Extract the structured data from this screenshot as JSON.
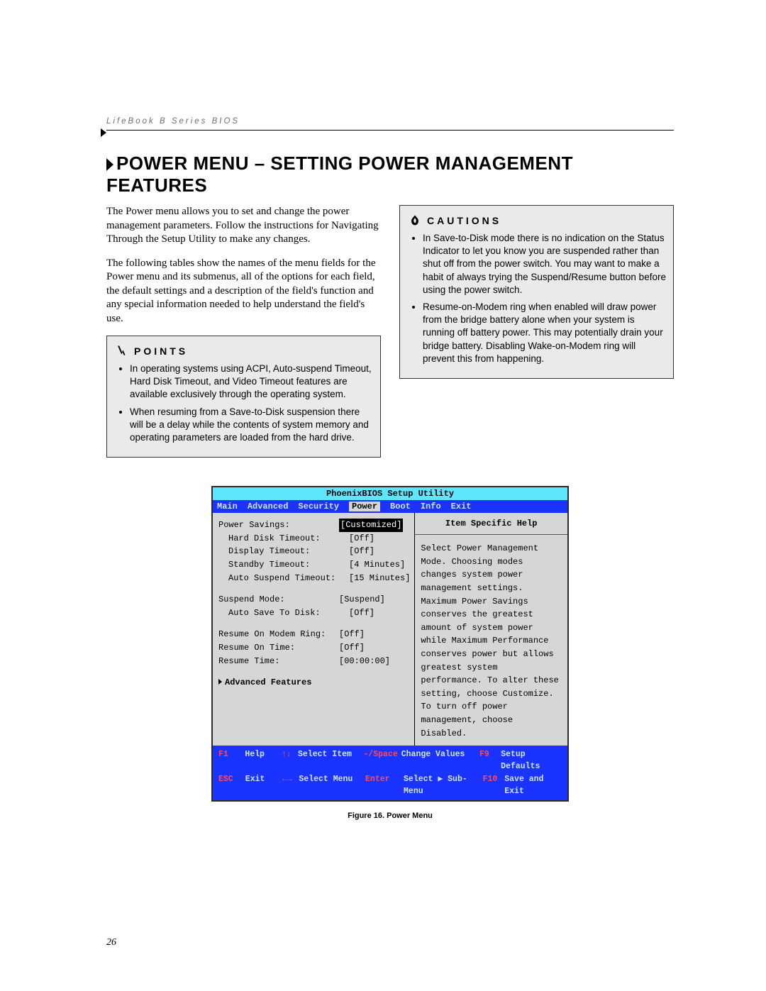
{
  "header": "LifeBook B Series BIOS",
  "title": "POWER MENU – SETTING POWER MANAGEMENT FEATURES",
  "intro": [
    "The Power menu allows you to set and change the power management parameters. Follow the instructions for Navigating Through the Setup Utility to make any changes.",
    "The following tables show the names of the menu fields for the Power menu and its submenus, all of the options for each field, the default settings and a description of the field's function and any special information needed to help understand the field's use."
  ],
  "points": {
    "label": "POINTS",
    "items": [
      "In operating systems using ACPI, Auto-suspend Timeout, Hard Disk Timeout, and Video Timeout features are available exclusively through the operating system.",
      "When resuming from a Save-to-Disk suspension there will be a delay while the contents of system memory and operating parameters are loaded from the hard drive."
    ]
  },
  "cautions": {
    "label": "CAUTIONS",
    "items": [
      "In Save-to-Disk mode there is no indication on the Status Indicator to let you know you are suspended rather than shut off from the power switch. You may want to make a habit of always trying the Suspend/Resume button before using the power switch.",
      "Resume-on-Modem ring when enabled will draw power from the bridge battery alone when your system is running off battery power. This may potentially drain your bridge battery. Disabling Wake-on-Modem ring will prevent this from happening."
    ]
  },
  "bios": {
    "title": "PhoenixBIOS Setup Utility",
    "tabs": [
      "Main",
      "Advanced",
      "Security",
      "Power",
      "Boot",
      "Info",
      "Exit"
    ],
    "active_tab": "Power",
    "help_title": "Item Specific Help",
    "help_text": "Select Power Management Mode. Choosing modes changes system power management settings. Maximum Power Savings conserves the greatest amount of system power while Maximum Performance conserves power but allows greatest system performance. To alter these setting, choose Customize. To turn off power management, choose Disabled.",
    "fields": [
      {
        "label": "Power Savings:",
        "value": "[Customized]",
        "indent": false,
        "selected": true
      },
      {
        "label": "Hard Disk Timeout:",
        "value": "[Off]",
        "indent": true
      },
      {
        "label": "Display Timeout:",
        "value": "[Off]",
        "indent": true
      },
      {
        "label": "Standby Timeout:",
        "value": "[4 Minutes]",
        "indent": true
      },
      {
        "label": "Auto Suspend Timeout:",
        "value": "[15 Minutes]",
        "indent": true
      },
      {
        "spacer": true
      },
      {
        "label": "Suspend Mode:",
        "value": "[Suspend]",
        "indent": false
      },
      {
        "label": "Auto Save To Disk:",
        "value": "[Off]",
        "indent": true
      },
      {
        "spacer": true
      },
      {
        "label": "Resume On Modem Ring:",
        "value": "[Off]",
        "indent": false
      },
      {
        "label": "Resume On Time:",
        "value": "[Off]",
        "indent": false
      },
      {
        "label": "Resume Time:",
        "value": "[00:00:00]",
        "indent": false
      },
      {
        "spacer": true
      },
      {
        "label": "Advanced Features",
        "value": "",
        "arrow": true,
        "bold": true
      }
    ],
    "footer": {
      "r1": {
        "k1": "F1",
        "l1": "Help",
        "k2": "↑↓",
        "l2": "Select Item",
        "k3": "-/Space",
        "l3": "Change Values",
        "k4": "F9",
        "l4": "Setup Defaults"
      },
      "r2": {
        "k1": "ESC",
        "l1": "Exit",
        "k2": "←→",
        "l2": "Select Menu",
        "k3": "Enter",
        "l3": "Select ▶ Sub-Menu",
        "k4": "F10",
        "l4": "Save and Exit"
      }
    }
  },
  "caption": "Figure 16.  Power Menu",
  "page_number": "26"
}
